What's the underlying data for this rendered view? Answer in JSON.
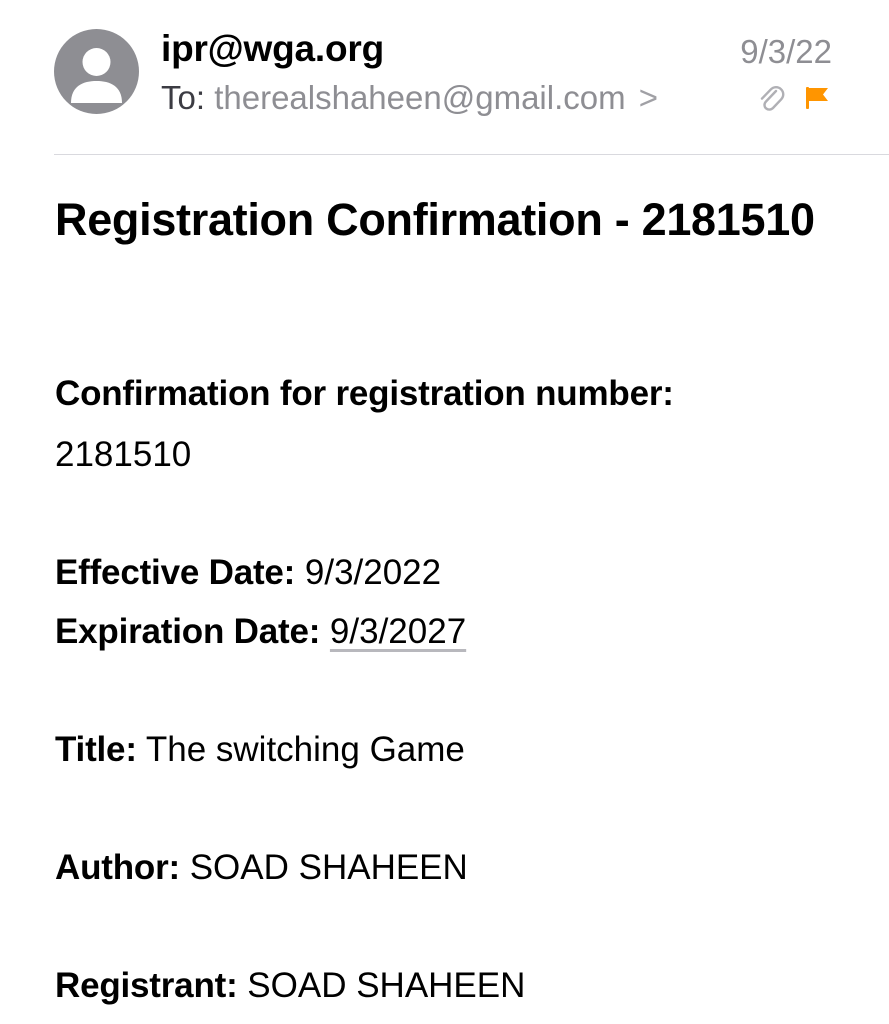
{
  "header": {
    "sender": "ipr@wga.org",
    "to_label": "To:",
    "to_address": "therealshaheen@gmail.com",
    "chevron": ">",
    "date": "9/3/22",
    "flag_color": "#FF9500"
  },
  "email": {
    "subject": "Registration Confirmation - 2181510",
    "confirmation_label": "Confirmation for registration number:",
    "registration_number": "2181510",
    "effective_label": "Effective Date:",
    "effective_value": "9/3/2022",
    "expiration_label": "Expiration Date:",
    "expiration_value": "9/3/2027",
    "title_label": "Title:",
    "title_value": "The switching Game",
    "author_label": "Author:",
    "author_value": "SOAD SHAHEEN",
    "registrant_label": "Registrant:",
    "registrant_value": "SOAD SHAHEEN"
  }
}
